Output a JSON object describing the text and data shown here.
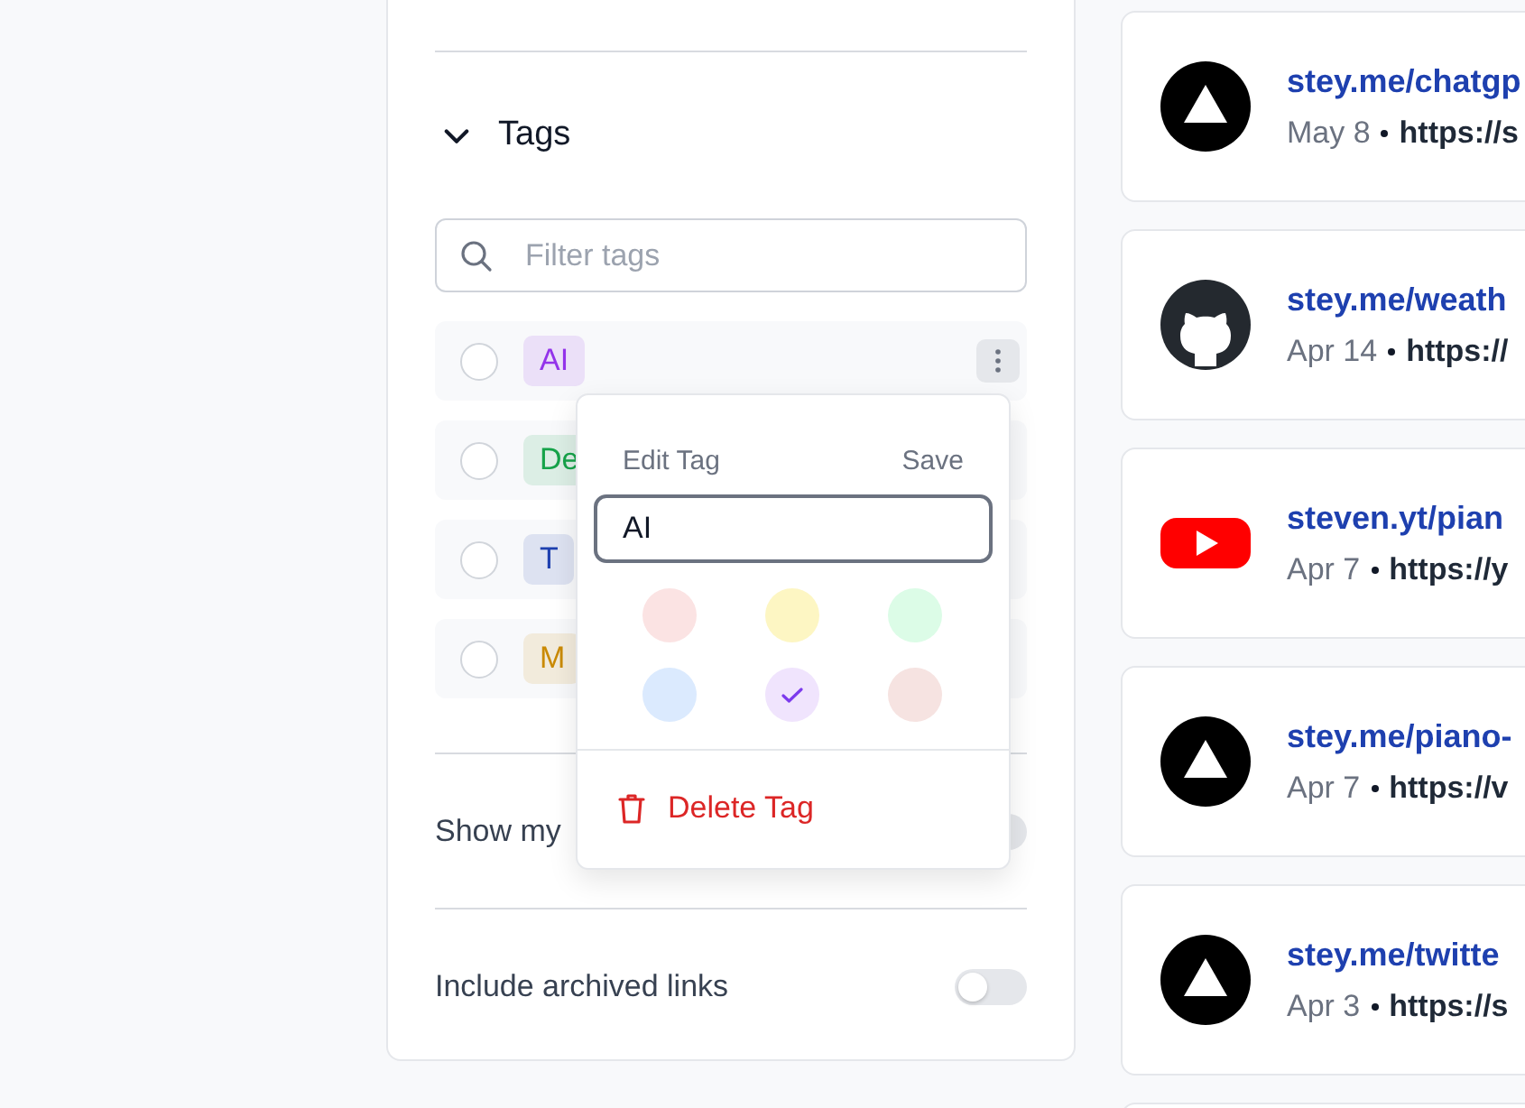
{
  "tags_section": {
    "title": "Tags",
    "expanded": true,
    "filter": {
      "placeholder": "Filter tags"
    },
    "tags": [
      {
        "label": "AI",
        "color": "#9333ea",
        "selected": false,
        "menu_open": true
      },
      {
        "label": "De",
        "color": "#16a34a",
        "selected": false,
        "menu_open": false
      },
      {
        "label": "T",
        "color": "#1e40af",
        "selected": false,
        "menu_open": false
      },
      {
        "label": "M",
        "color": "#ca8a04",
        "selected": false,
        "menu_open": false
      }
    ]
  },
  "settings": [
    {
      "label": "Show my",
      "on": false
    },
    {
      "label": "Include archived links",
      "on": false
    }
  ],
  "edit_popup": {
    "title": "Edit Tag",
    "save": "Save",
    "value": "AI",
    "colors": [
      {
        "color": "#fbe3e3",
        "selected": false
      },
      {
        "color": "#fdf6c3",
        "selected": false
      },
      {
        "color": "#dcfce7",
        "selected": false
      },
      {
        "color": "#dbeafe",
        "selected": false
      },
      {
        "color": "#f0e4fd",
        "selected": true
      },
      {
        "color": "#f6e3e1",
        "selected": false
      }
    ],
    "delete": "Delete Tag"
  },
  "links": [
    {
      "kind": "triangle",
      "title": "stey.me/chatgp",
      "date": "May 8",
      "url": "https://s"
    },
    {
      "kind": "github",
      "title": "stey.me/weath",
      "date": "Apr 14",
      "url": "https://"
    },
    {
      "kind": "youtube",
      "title": "steven.yt/pian",
      "date": "Apr 7",
      "url": "https://y"
    },
    {
      "kind": "triangle",
      "title": "stey.me/piano-",
      "date": "Apr 7",
      "url": "https://v"
    },
    {
      "kind": "triangle",
      "title": "stey.me/twitte",
      "date": "Apr 3",
      "url": "https://s"
    }
  ]
}
